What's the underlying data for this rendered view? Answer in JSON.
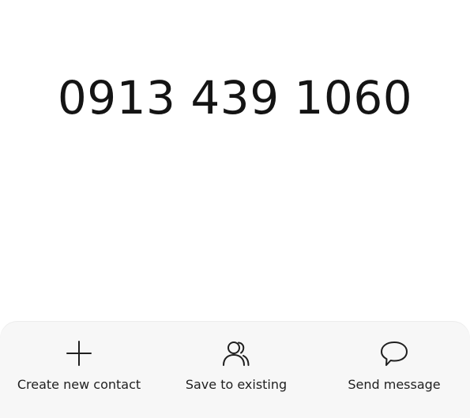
{
  "dialer": {
    "number": "0913 439 1060"
  },
  "actions": [
    {
      "label": "Create new contact",
      "icon": "plus-icon"
    },
    {
      "label": "Save to existing",
      "icon": "contacts-icon"
    },
    {
      "label": "Send message",
      "icon": "message-bubble-icon"
    }
  ]
}
